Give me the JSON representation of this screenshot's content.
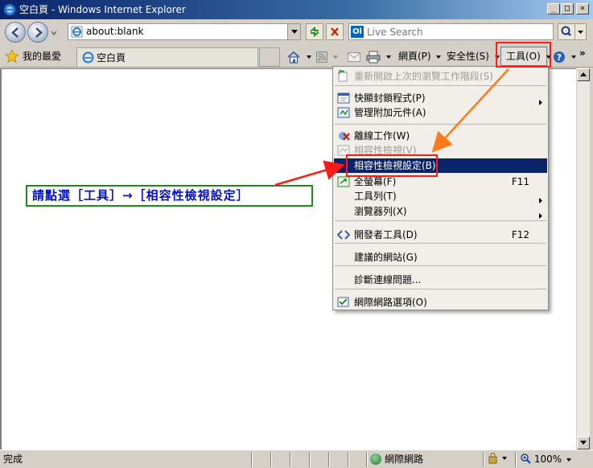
{
  "window": {
    "title": "空白頁 - Windows Internet Explorer",
    "minimize_glyph": "_",
    "maximize_glyph": "□",
    "close_glyph": "×"
  },
  "navbar": {
    "address_value": "about:blank",
    "search_placeholder": "Live Search",
    "search_logo_text": "Ol"
  },
  "commandbar": {
    "favorites_label": "我的最愛",
    "tab_title": "空白頁",
    "page_label": "網頁(P)",
    "safety_label": "安全性(S)",
    "tools_label": "工具(O)",
    "overflow_glyph": "»"
  },
  "tools_menu": {
    "items": [
      {
        "label": "重新開啟上次的瀏覽工作階段(S)",
        "shortcut": "",
        "submenu": false,
        "disabled": true,
        "selected": false,
        "icon": "reopen-session-icon"
      },
      {
        "label": "快顯封鎖程式(P)",
        "shortcut": "",
        "submenu": true,
        "disabled": false,
        "selected": false,
        "icon": "popup-blocker-icon"
      },
      {
        "label": "管理附加元件(A)",
        "shortcut": "",
        "submenu": false,
        "disabled": false,
        "selected": false,
        "icon": "addons-icon"
      },
      {
        "label": "離線工作(W)",
        "shortcut": "",
        "submenu": false,
        "disabled": false,
        "selected": false,
        "icon": "offline-icon"
      },
      {
        "label": "相容性檢視(V)",
        "shortcut": "",
        "submenu": false,
        "disabled": true,
        "selected": false,
        "icon": "compat-view-icon"
      },
      {
        "label": "相容性檢視設定(B)",
        "shortcut": "",
        "submenu": false,
        "disabled": false,
        "selected": true,
        "icon": ""
      },
      {
        "label": "全螢幕(F)",
        "shortcut": "F11",
        "submenu": false,
        "disabled": false,
        "selected": false,
        "icon": "fullscreen-icon"
      },
      {
        "label": "工具列(T)",
        "shortcut": "",
        "submenu": true,
        "disabled": false,
        "selected": false,
        "icon": ""
      },
      {
        "label": "瀏覽器列(X)",
        "shortcut": "",
        "submenu": true,
        "disabled": false,
        "selected": false,
        "icon": ""
      },
      {
        "label": "開發者工具(D)",
        "shortcut": "F12",
        "submenu": false,
        "disabled": false,
        "selected": false,
        "icon": "dev-tools-icon"
      },
      {
        "label": "建議的網站(G)",
        "shortcut": "",
        "submenu": false,
        "disabled": false,
        "selected": false,
        "icon": ""
      },
      {
        "label": "診斷連線問題...",
        "shortcut": "",
        "submenu": false,
        "disabled": false,
        "selected": false,
        "icon": ""
      },
      {
        "label": "網際網路選項(O)",
        "shortcut": "",
        "submenu": false,
        "disabled": false,
        "selected": false,
        "icon": "internet-options-icon"
      }
    ]
  },
  "annotation": {
    "text": "請點選［工具］→［相容性檢視設定］"
  },
  "statusbar": {
    "status_text": "完成",
    "zone_label": "網際網路",
    "zoom_label": "100%"
  },
  "colors": {
    "highlight_red": "#ff1a1a",
    "arrow_orange": "#ff7a1a",
    "note_text_blue": "#0010c0",
    "note_border_green": "#1f8a1f",
    "menu_selected_bg": "#0a246a"
  }
}
